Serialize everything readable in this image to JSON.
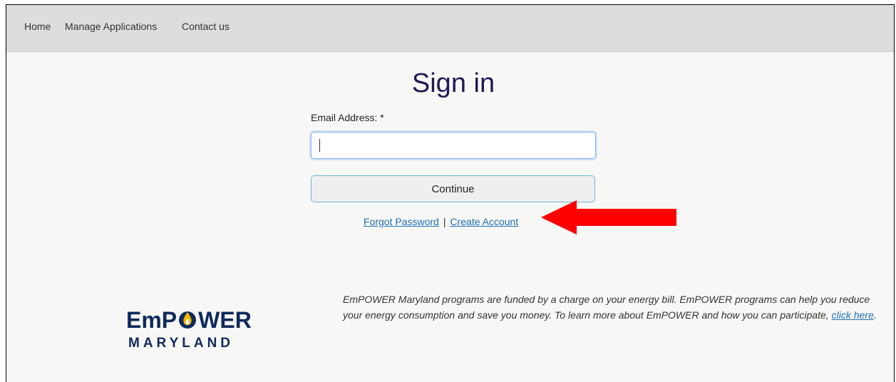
{
  "nav": {
    "home": "Home",
    "manage_applications": "Manage Applications",
    "contact_us": "Contact us"
  },
  "signin": {
    "title": "Sign in",
    "email_label": "Email Address: *",
    "email_value": "",
    "continue_label": "Continue",
    "forgot_password": "Forgot Password",
    "separator": "|",
    "create_account": "Create Account"
  },
  "annotation": {
    "arrow_color": "#ff0000",
    "points_to": "create_account"
  },
  "logo": {
    "line1_a": "EmP",
    "line1_b": "WER",
    "line2": "MARYLAND",
    "flame_color": "#f5b800",
    "text_color": "#0f2a5c"
  },
  "footer": {
    "info_text": "EmPOWER Maryland programs are funded by a charge on your energy bill. EmPOWER programs can help you reduce your energy consumption and save you money. To learn more about EmPOWER and how you can participate, ",
    "info_link": "click here",
    "info_end": "."
  },
  "colors": {
    "title": "#1e1a55",
    "link": "#1f6fb2",
    "nav_bg": "#dddddd"
  }
}
